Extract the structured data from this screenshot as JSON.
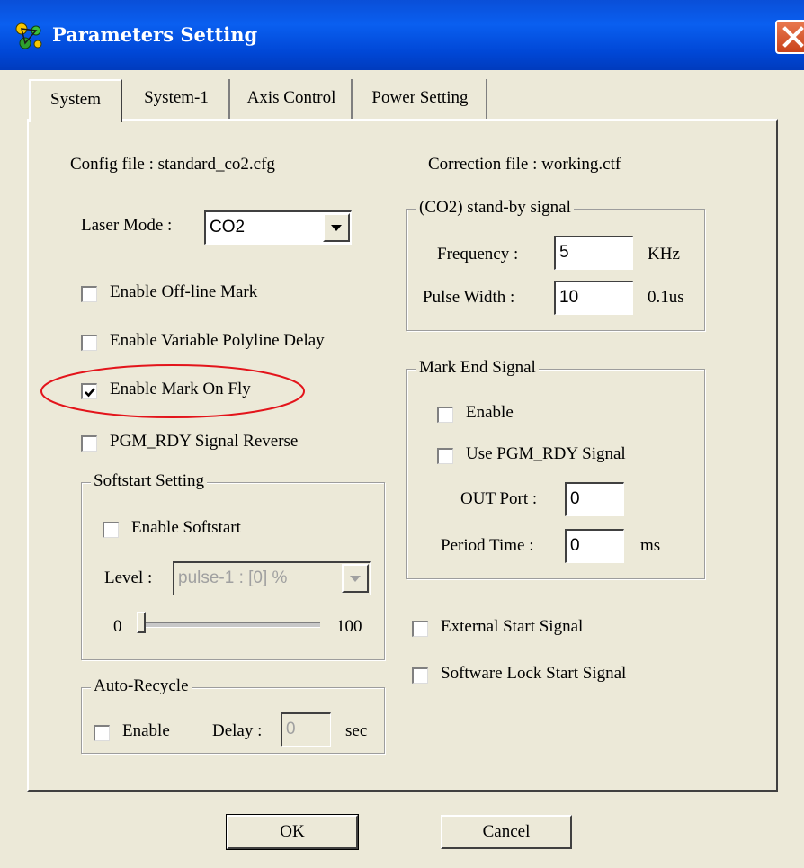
{
  "window": {
    "title": "Parameters Setting"
  },
  "tabs": [
    {
      "label": "System",
      "active": true
    },
    {
      "label": "System-1",
      "active": false
    },
    {
      "label": "Axis Control",
      "active": false
    },
    {
      "label": "Power Setting",
      "active": false
    }
  ],
  "system": {
    "config_file": "Config file : standard_co2.cfg",
    "correction_file": "Correction file : working.ctf",
    "laser_mode_label": "Laser Mode :",
    "laser_mode_value": "CO2",
    "enable_offline_mark": {
      "label": "Enable Off-line Mark",
      "checked": false
    },
    "enable_variable_polyline_delay": {
      "label": "Enable Variable Polyline Delay",
      "checked": false
    },
    "enable_mark_on_fly": {
      "label": "Enable Mark On Fly",
      "checked": true,
      "highlighted": true,
      "highlight_color": "#e3141b"
    },
    "pgm_rdy_signal_reverse": {
      "label": "PGM_RDY Signal Reverse",
      "checked": false
    },
    "softstart": {
      "title": "Softstart Setting",
      "enable_label": "Enable Softstart",
      "enabled": false,
      "level_label": "Level :",
      "level_value": "pulse-1 : [0] %",
      "slider_min": "0",
      "slider_max": "100",
      "slider_value": 0
    },
    "auto_recycle": {
      "title": "Auto-Recycle",
      "enable_label": "Enable",
      "enabled": false,
      "delay_label": "Delay :",
      "delay_value": "0",
      "delay_unit": "sec"
    },
    "standby_signal": {
      "title": "(CO2) stand-by signal",
      "frequency_label": "Frequency :",
      "frequency_value": "5",
      "frequency_unit": "KHz",
      "pulse_width_label": "Pulse Width :",
      "pulse_width_value": "10",
      "pulse_width_unit": "0.1us"
    },
    "mark_end_signal": {
      "title": "Mark End Signal",
      "enable_label": "Enable",
      "enabled": false,
      "use_pgm_rdy_label": "Use PGM_RDY Signal",
      "use_pgm_rdy": false,
      "out_port_label": "OUT Port :",
      "out_port_value": "0",
      "period_time_label": "Period Time :",
      "period_time_value": "0",
      "period_time_unit": "ms"
    },
    "external_start_signal": {
      "label": "External Start Signal",
      "checked": false
    },
    "software_lock_start_signal": {
      "label": "Software Lock Start Signal",
      "checked": false
    }
  },
  "buttons": {
    "ok": "OK",
    "cancel": "Cancel"
  },
  "colors": {
    "titlebar": "#0a5ff0",
    "dialog_bg": "#ece9d8",
    "highlight": "#e3141b",
    "close_button": "#d9572c"
  }
}
